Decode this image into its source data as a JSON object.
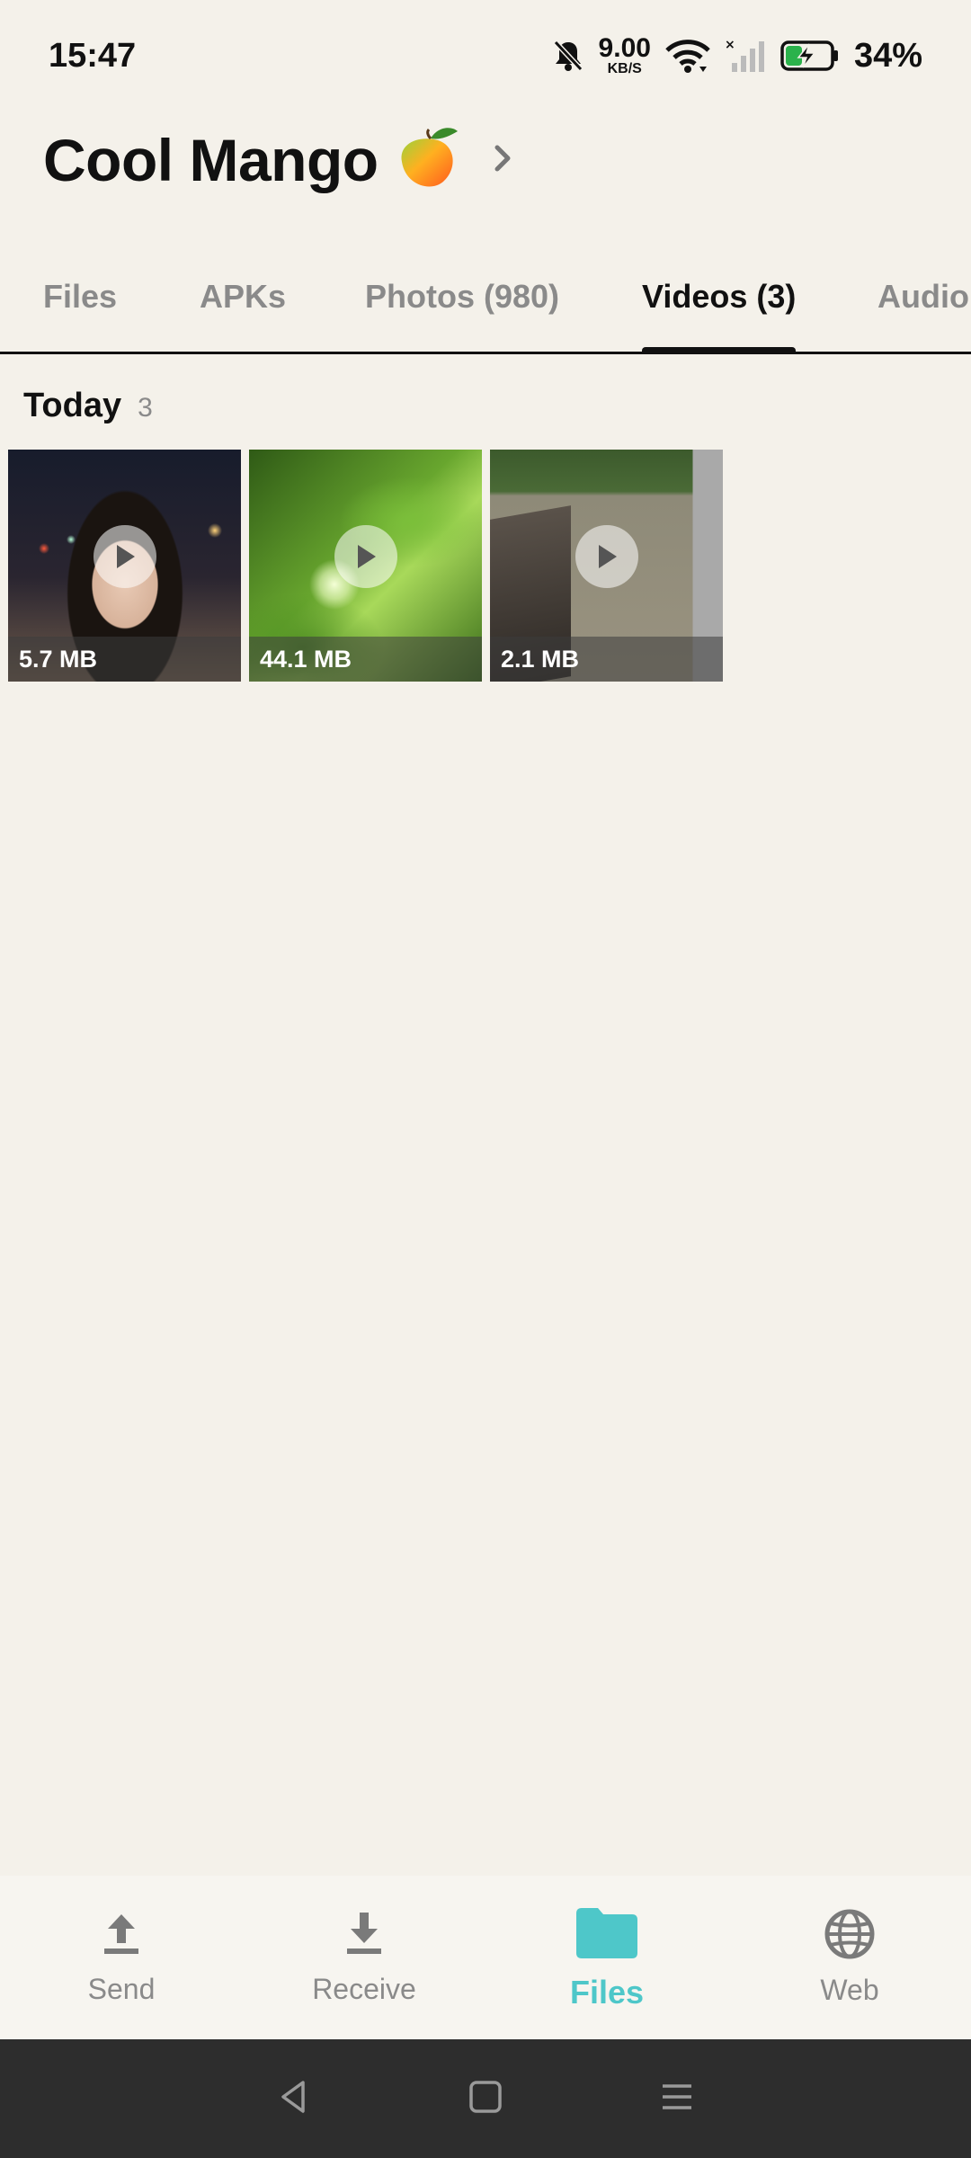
{
  "status_bar": {
    "time": "15:47",
    "net_speed_value": "9.00",
    "net_speed_unit": "KB/S",
    "battery_percent": "34%",
    "icons": [
      "mute-bell-icon",
      "wifi-icon",
      "cellular-no-signal-icon",
      "battery-charging-icon"
    ]
  },
  "header": {
    "device_name": "Cool Mango",
    "emoji_icon": "mango-icon",
    "chevron_icon": "chevron-right-icon"
  },
  "tabs": [
    {
      "label": "Files",
      "active": false
    },
    {
      "label": "APKs",
      "active": false
    },
    {
      "label": "Photos (980)",
      "active": false
    },
    {
      "label": "Videos (3)",
      "active": true
    },
    {
      "label": "Audio",
      "active": false
    }
  ],
  "section": {
    "title": "Today",
    "count": "3"
  },
  "videos": [
    {
      "size": "5.7 MB",
      "icon": "play-icon"
    },
    {
      "size": "44.1 MB",
      "icon": "play-icon"
    },
    {
      "size": "2.1 MB",
      "icon": "play-icon"
    }
  ],
  "bottom_nav": [
    {
      "label": "Send",
      "icon": "upload-icon",
      "active": false
    },
    {
      "label": "Receive",
      "icon": "download-icon",
      "active": false
    },
    {
      "label": "Files",
      "icon": "folder-icon",
      "active": true
    },
    {
      "label": "Web",
      "icon": "globe-icon",
      "active": false
    }
  ],
  "colors": {
    "background": "#f4f1ea",
    "accent": "#4ec7c9",
    "inactive": "#8a8a8a",
    "system_nav": "#2d2d2d"
  }
}
